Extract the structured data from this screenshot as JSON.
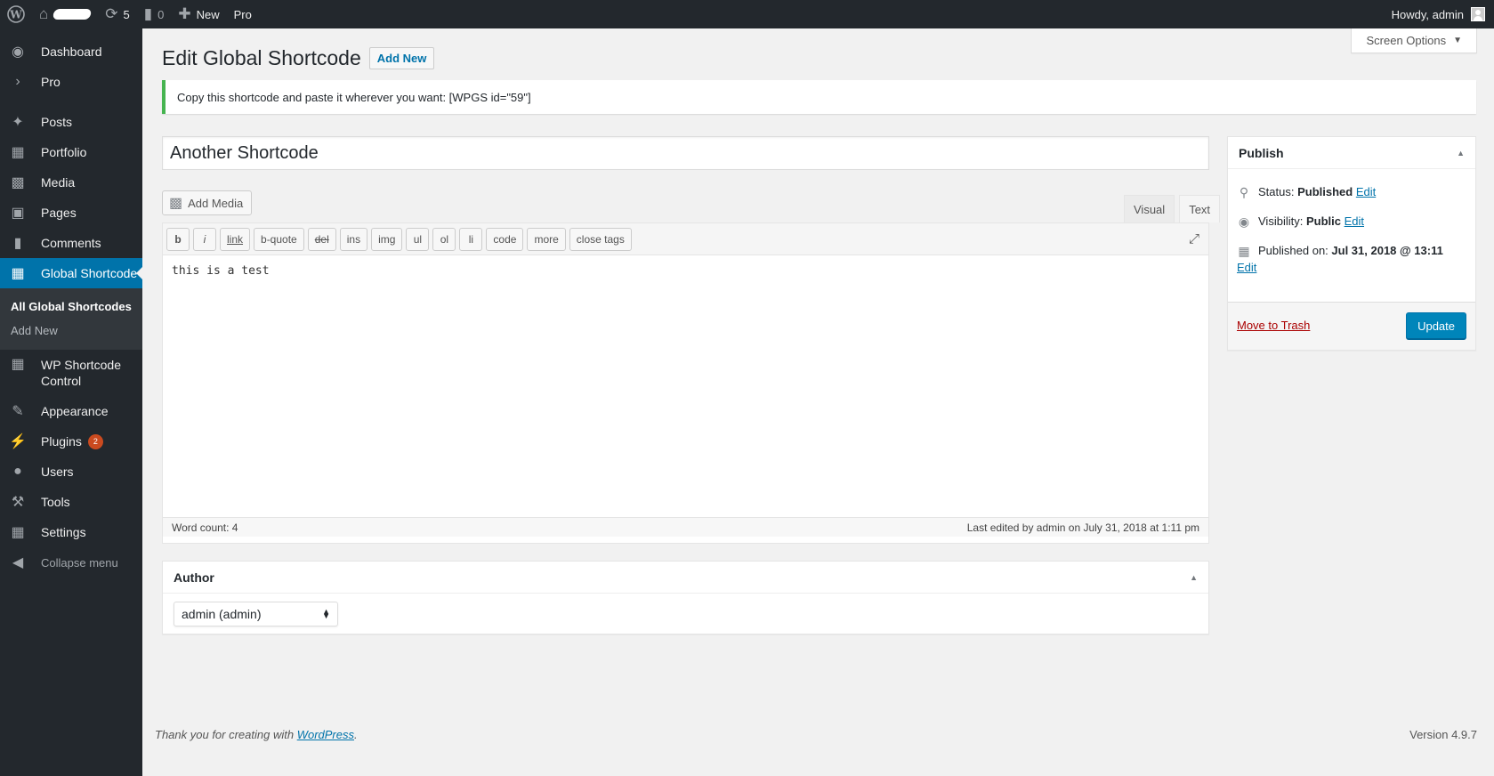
{
  "adminbar": {
    "updates_count": "5",
    "comments_count": "0",
    "new_label": "New",
    "pro_label": "Pro",
    "howdy": "Howdy, admin"
  },
  "sidebar": {
    "items": [
      {
        "label": "Dashboard",
        "icon": "dashboard-icon"
      },
      {
        "label": "Pro",
        "icon": "chevron-right-icon"
      },
      {
        "label": "Posts",
        "icon": "pushpin-icon"
      },
      {
        "label": "Portfolio",
        "icon": "portfolio-icon"
      },
      {
        "label": "Media",
        "icon": "media-icon"
      },
      {
        "label": "Pages",
        "icon": "pages-icon"
      },
      {
        "label": "Comments",
        "icon": "comments-icon"
      },
      {
        "label": "Global Shortcode",
        "icon": "grid-icon"
      },
      {
        "label": "WP Shortcode Control",
        "icon": "grid-icon"
      },
      {
        "label": "Appearance",
        "icon": "brush-icon"
      },
      {
        "label": "Plugins",
        "icon": "plugin-icon",
        "badge": "2"
      },
      {
        "label": "Users",
        "icon": "users-icon"
      },
      {
        "label": "Tools",
        "icon": "wrench-icon"
      },
      {
        "label": "Settings",
        "icon": "settings-icon"
      }
    ],
    "submenu": [
      "All Global Shortcodes",
      "Add New"
    ],
    "collapse": "Collapse menu"
  },
  "header": {
    "screen_options": "Screen Options",
    "title": "Edit Global Shortcode",
    "add_new": "Add New"
  },
  "notice": "Copy this shortcode and paste it wherever you want: [WPGS id=\"59\"]",
  "post_title": "Another Shortcode",
  "editor": {
    "add_media": "Add Media",
    "tabs": [
      "Visual",
      "Text"
    ],
    "quicktags": [
      "b",
      "i",
      "link",
      "b-quote",
      "del",
      "ins",
      "img",
      "ul",
      "ol",
      "li",
      "code",
      "more",
      "close tags"
    ],
    "content": "this is a test",
    "word_count": "Word count: 4",
    "last_edited": "Last edited by admin on July 31, 2018 at 1:11 pm"
  },
  "author": {
    "heading": "Author",
    "selected": "admin (admin)"
  },
  "publish": {
    "heading": "Publish",
    "status_label": "Status:",
    "status_value": "Published",
    "visibility_label": "Visibility:",
    "visibility_value": "Public",
    "published_label": "Published on:",
    "published_value": "Jul 31, 2018 @ 13:11",
    "edit": "Edit",
    "trash": "Move to Trash",
    "update": "Update"
  },
  "footer": {
    "thanks_prefix": "Thank you for creating with",
    "wordpress": "WordPress",
    "version": "Version 4.9.7"
  },
  "colors": {
    "admin_dark": "#23282d",
    "accent": "#0073aa",
    "button_primary": "#0085ba",
    "notice_success": "#46b450",
    "trash": "#a00"
  }
}
